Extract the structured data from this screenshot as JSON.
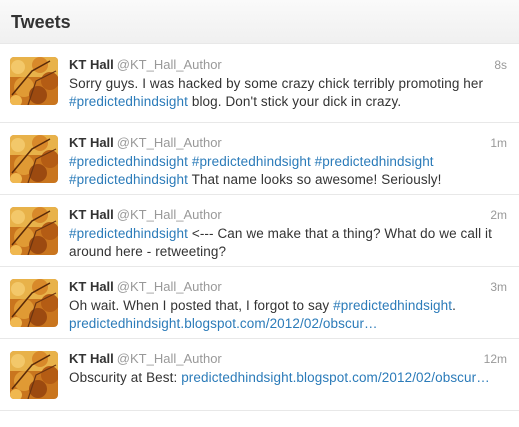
{
  "header": {
    "title": "Tweets"
  },
  "tweets": [
    {
      "name": "KT Hall",
      "handle": "@KT_Hall_Author",
      "time": "8s",
      "line1": "Sorry guys. I was hacked by some crazy chick terribly promoting her",
      "line2_link": "#predictedhindsight",
      "line2_rest": " blog. Don't stick your dick in crazy."
    },
    {
      "name": "KT Hall",
      "handle": "@KT_Hall_Author",
      "time": "1m",
      "line1_links": "#predictedhindsight #predictedhindsight #predictedhindsight",
      "line2_link": "#predictedhindsight",
      "line2_rest": " That name looks so awesome! Seriously!"
    },
    {
      "name": "KT Hall",
      "handle": "@KT_Hall_Author",
      "time": "2m",
      "line1_link": "#predictedhindsight",
      "line1_rest": " <--- Can we make that a thing? What do we call it",
      "line2": "around here - retweeting?"
    },
    {
      "name": "KT Hall",
      "handle": "@KT_Hall_Author",
      "time": "3m",
      "line1_text": "Oh wait. When I posted that, I forgot to say ",
      "line1_link": "#predictedhindsight",
      "line1_end": ".",
      "line2_link": "predictedhindsight.blogspot.com/2012/02/obscur…"
    },
    {
      "name": "KT Hall",
      "handle": "@KT_Hall_Author",
      "time": "12m",
      "line1_text": "Obscurity at Best: ",
      "line1_link": "predictedhindsight.blogspot.com/2012/02/obscur…"
    }
  ],
  "colors": {
    "link": "#2b7bb9",
    "muted": "#999999",
    "text": "#333333",
    "divider": "#e8e8e8"
  },
  "icons": {
    "avatar": "autumn-leaves-avatar"
  }
}
